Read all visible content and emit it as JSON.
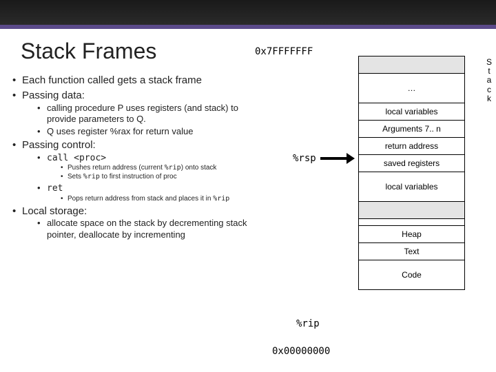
{
  "title": "Stack Frames",
  "addr_top": "0x7FFFFFFF",
  "addr_bottom": "0x00000000",
  "rsp": "%rsp",
  "rip": "%rip",
  "stack_vert": "Stack",
  "bullets": {
    "a": "Each function called gets a stack frame",
    "b": "Passing data:",
    "b1": "calling procedure P uses registers (and stack) to provide parameters to Q.",
    "b2": "Q uses register %rax for return value",
    "c": "Passing control:",
    "c1": "call <proc>",
    "c1a": "Pushes return address (current ",
    "c1aM": "%rip",
    "c1b": ") onto stack",
    "c1c": "Sets ",
    "c1cM": "%rip",
    "c1d": " to first instruction of proc",
    "c2": "ret",
    "c2a": "Pops return address from stack and places it in ",
    "c2aM": "%rip",
    "d": "Local storage:",
    "d1": "allocate space on the stack by decrementing stack pointer, deallocate by incrementing"
  },
  "cells": {
    "ellipsis": "…",
    "lv1": "local variables",
    "args": "Arguments 7.. n",
    "ret": "return address",
    "saved": "saved registers",
    "lv2": "local variables",
    "heap": "Heap",
    "text": "Text",
    "code": "Code"
  }
}
